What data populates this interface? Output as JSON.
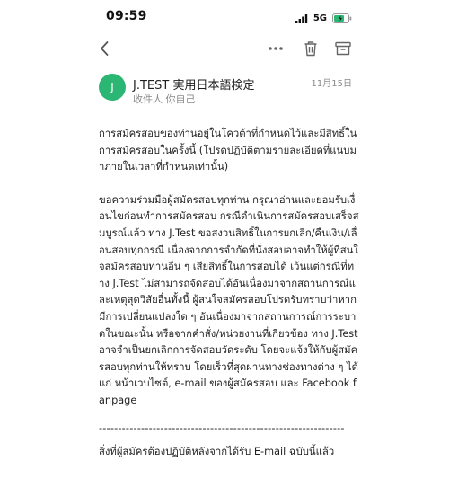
{
  "status_bar": {
    "time": "09:59",
    "network": "5G",
    "icons": [
      "signal-icon",
      "battery-icon"
    ]
  },
  "toolbar": {
    "icons": [
      "back-chevron-icon",
      "more-icon",
      "trash-icon",
      "archive-icon"
    ]
  },
  "email": {
    "avatar_letter": "J",
    "sender": "J.TEST 実用日本語検定",
    "recipient": "收件人 你自己",
    "date": "11月15日",
    "paragraph_1": "การสมัครสอบของท่านอยู่ในโควต้าที่กำหนดไว้และมีสิทธิ์ในการสมัครสอบในครั้งนี้ (โปรดปฏิบัติตามรายละเอียดที่แนบมาภายในเวลาที่กำหนดเท่านั้น)",
    "paragraph_2": "ขอความร่วมมือผู้สมัครสอบทุกท่าน กรุณาอ่านและยอมรับเงื่อนไขก่อนทำการสมัครสอบ กรณีดำเนินการสมัครสอบเสร็จสมบูรณ์แล้ว ทาง J.Test ขอสงวนสิทธิ์ในการยกเลิก/คืนเงิน/เลื่อนสอบทุกกรณี เนื่องจากการจำกัดที่นั่งสอบอาจทำให้ผู้ที่สนใจสมัครสอบท่านอื่น ๆ เสียสิทธิ์ในการสอบได้ เว้นแต่กรณีที่ทาง J.Test ไม่สามารถจัดสอบได้อันเนื่องมาจากสถานการณ์และเหตุสุดวิสัยอื่นทั้งนี้ ผู้สนใจสมัครสอบโปรดรับทราบว่าหากมีการเปลี่ยนแปลงใด ๆ อันเนื่องมาจากสถานการณ์การระบาดในขณะนั้น หรือจากคำสั่ง/หน่วยงานที่เกี่ยวข้อง ทาง J.Test อาจจำเป็นยกเลิกการจัดสอบวัดระดับ โดยจะแจ้งให้กับผู้สมัครสอบทุกท่านให้ทราบ โดยเร็วที่สุดผ่านทางช่องทางต่าง ๆ ได้แก่ หน้าเวบไซต์, e-mail ของผู้สมัครสอบ และ Facebook fanpage",
    "divider": "----------------------------------------------------------------",
    "paragraph_3": "สิ่งที่ผู้สมัครต้องปฏิบัติหลังจากได้รับ E-mail ฉบับนี้แล้ว"
  }
}
